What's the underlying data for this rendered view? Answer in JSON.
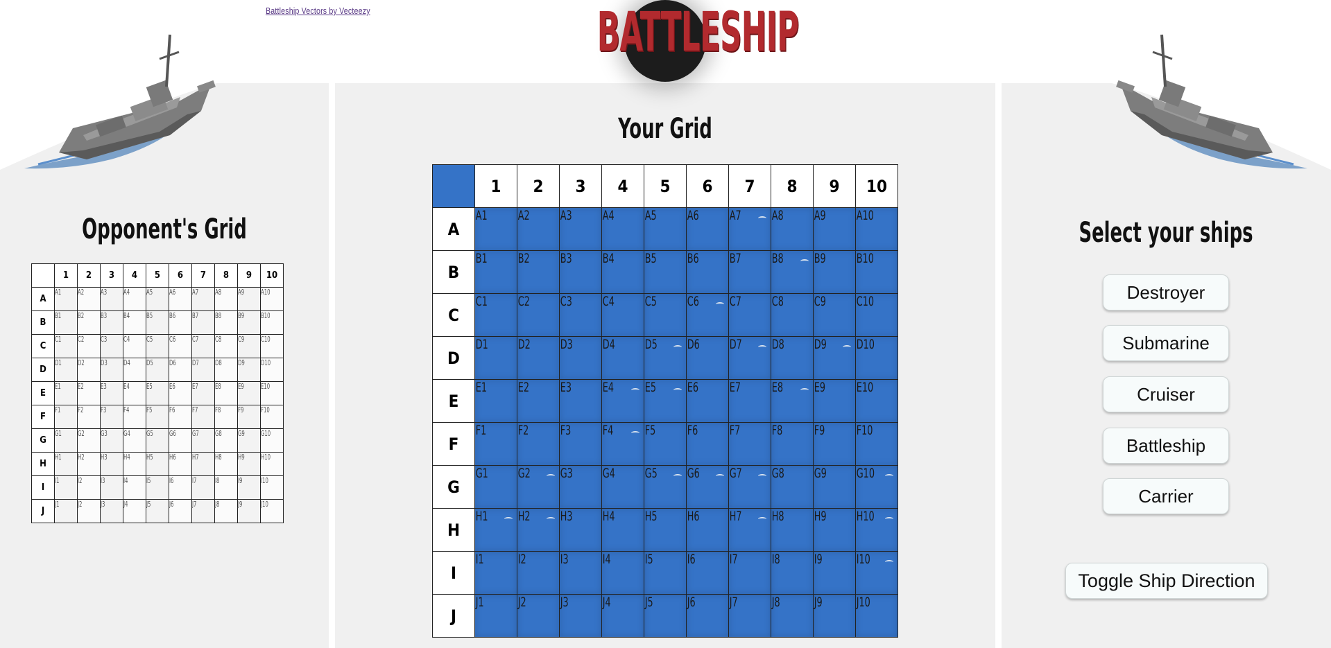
{
  "credit_link": "Battleship Vectors by Vecteezy",
  "logo_text": "BATTLESHIP",
  "opponent_title": "Opponent's Grid",
  "your_title": "Your Grid",
  "select_title": "Select your ships",
  "columns": [
    "1",
    "2",
    "3",
    "4",
    "5",
    "6",
    "7",
    "8",
    "9",
    "10"
  ],
  "rows": [
    "A",
    "B",
    "C",
    "D",
    "E",
    "F",
    "G",
    "H",
    "I",
    "J"
  ],
  "ship_buttons": [
    "Destroyer",
    "Submarine",
    "Cruiser",
    "Battleship",
    "Carrier"
  ],
  "toggle_label": "Toggle Ship Direction",
  "colors": {
    "grid_water": "#3573c7",
    "logo_red": "#b22a2e",
    "panel_bg": "#f0f0f0"
  },
  "icons": [
    "battleship-icon-left",
    "battleship-icon-right",
    "wave-icon"
  ]
}
